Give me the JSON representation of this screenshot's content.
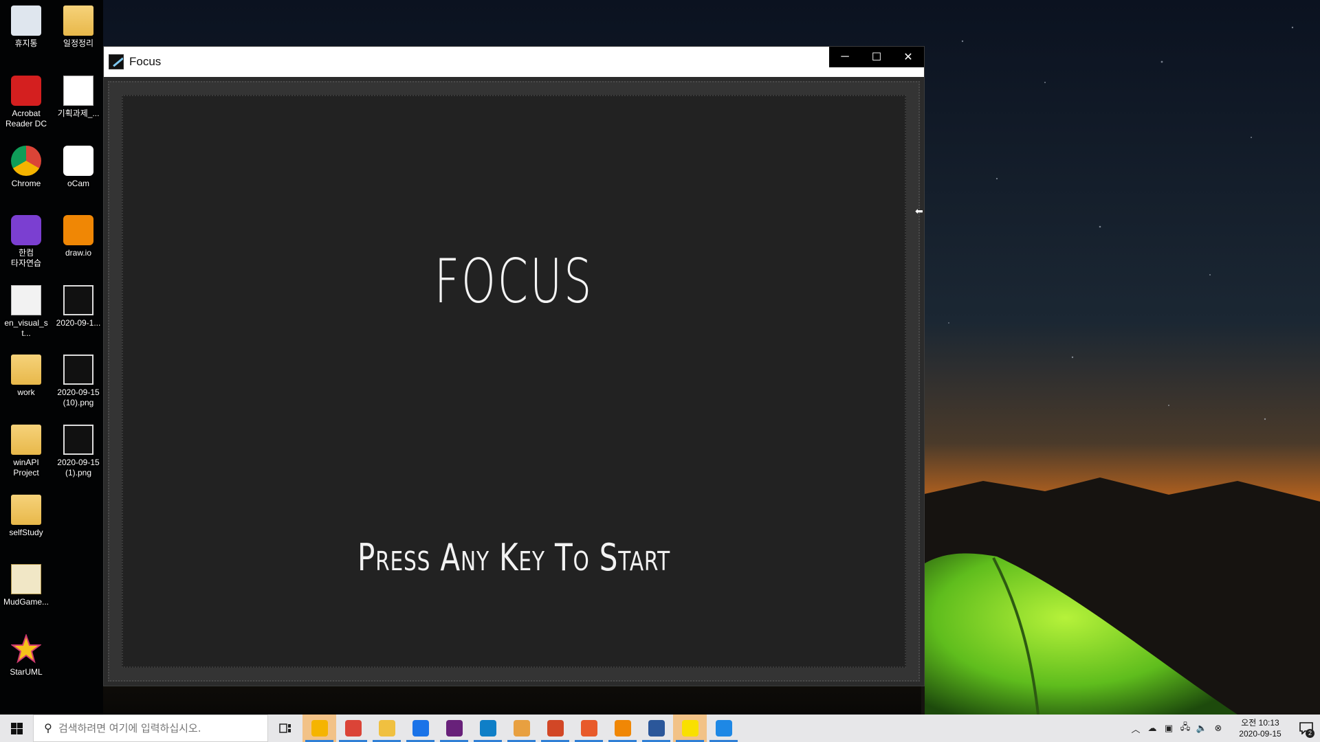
{
  "desktop": {
    "icons": [
      {
        "label": "휴지통",
        "icon": "recycle-bin-icon"
      },
      {
        "label": "일정정리",
        "icon": "folder-icon"
      },
      {
        "label": "Acrobat\nReader DC",
        "icon": "acrobat-reader-icon"
      },
      {
        "label": "기획과제_...",
        "icon": "word-document-icon"
      },
      {
        "label": "Chrome",
        "icon": "chrome-icon"
      },
      {
        "label": "oCam",
        "icon": "ocam-icon"
      },
      {
        "label": "한컴\n타자연습",
        "icon": "hancom-typing-icon"
      },
      {
        "label": "draw.io",
        "icon": "drawio-icon"
      },
      {
        "label": "en_visual_st...",
        "icon": "disc-image-icon"
      },
      {
        "label": "2020-09-1...",
        "icon": "image-file-icon"
      },
      {
        "label": "work",
        "icon": "folder-icon"
      },
      {
        "label": "2020-09-15\n(10).png",
        "icon": "image-file-icon"
      },
      {
        "label": "winAPI\nProject",
        "icon": "folder-icon"
      },
      {
        "label": "2020-09-15\n(1).png",
        "icon": "image-file-icon"
      },
      {
        "label": "selfStudy",
        "icon": "folder-icon"
      },
      {
        "label": "MudGame...",
        "icon": "archive-icon"
      },
      {
        "label": "StarUML",
        "icon": "staruml-icon"
      }
    ]
  },
  "window": {
    "title": "Focus",
    "controls": {
      "minimize": "─",
      "maximize": "☐",
      "close": "✕"
    }
  },
  "game": {
    "title": "FOCUS",
    "prompt": "Press Any Key To Start"
  },
  "taskbar": {
    "search_placeholder": "검색하려면 여기에 입력하십시오.",
    "apps": [
      {
        "name": "sticky-notes",
        "color": "#f5b400"
      },
      {
        "name": "chrome",
        "color": "#db4437"
      },
      {
        "name": "file-explorer",
        "color": "#f0c040"
      },
      {
        "name": "maps",
        "color": "#1a73e8"
      },
      {
        "name": "visual-studio",
        "color": "#68217a"
      },
      {
        "name": "edge",
        "color": "#0f7fc7"
      },
      {
        "name": "git",
        "color": "#e8a040"
      },
      {
        "name": "powerpoint",
        "color": "#d24726"
      },
      {
        "name": "ocam",
        "color": "#e85a2a"
      },
      {
        "name": "drawio",
        "color": "#f08705"
      },
      {
        "name": "word",
        "color": "#2b579a"
      },
      {
        "name": "kakaotalk",
        "color": "#f9e000"
      },
      {
        "name": "media-player",
        "color": "#1e88e5"
      }
    ],
    "clock_period_time": "오전 10:13",
    "clock_date": "2020-09-15",
    "notification_count": "2"
  },
  "colors": {
    "game_background": "#222222",
    "game_text": "#f4f4f4",
    "taskbar": "#e7e7e9",
    "accent": "#2f7fd6"
  }
}
